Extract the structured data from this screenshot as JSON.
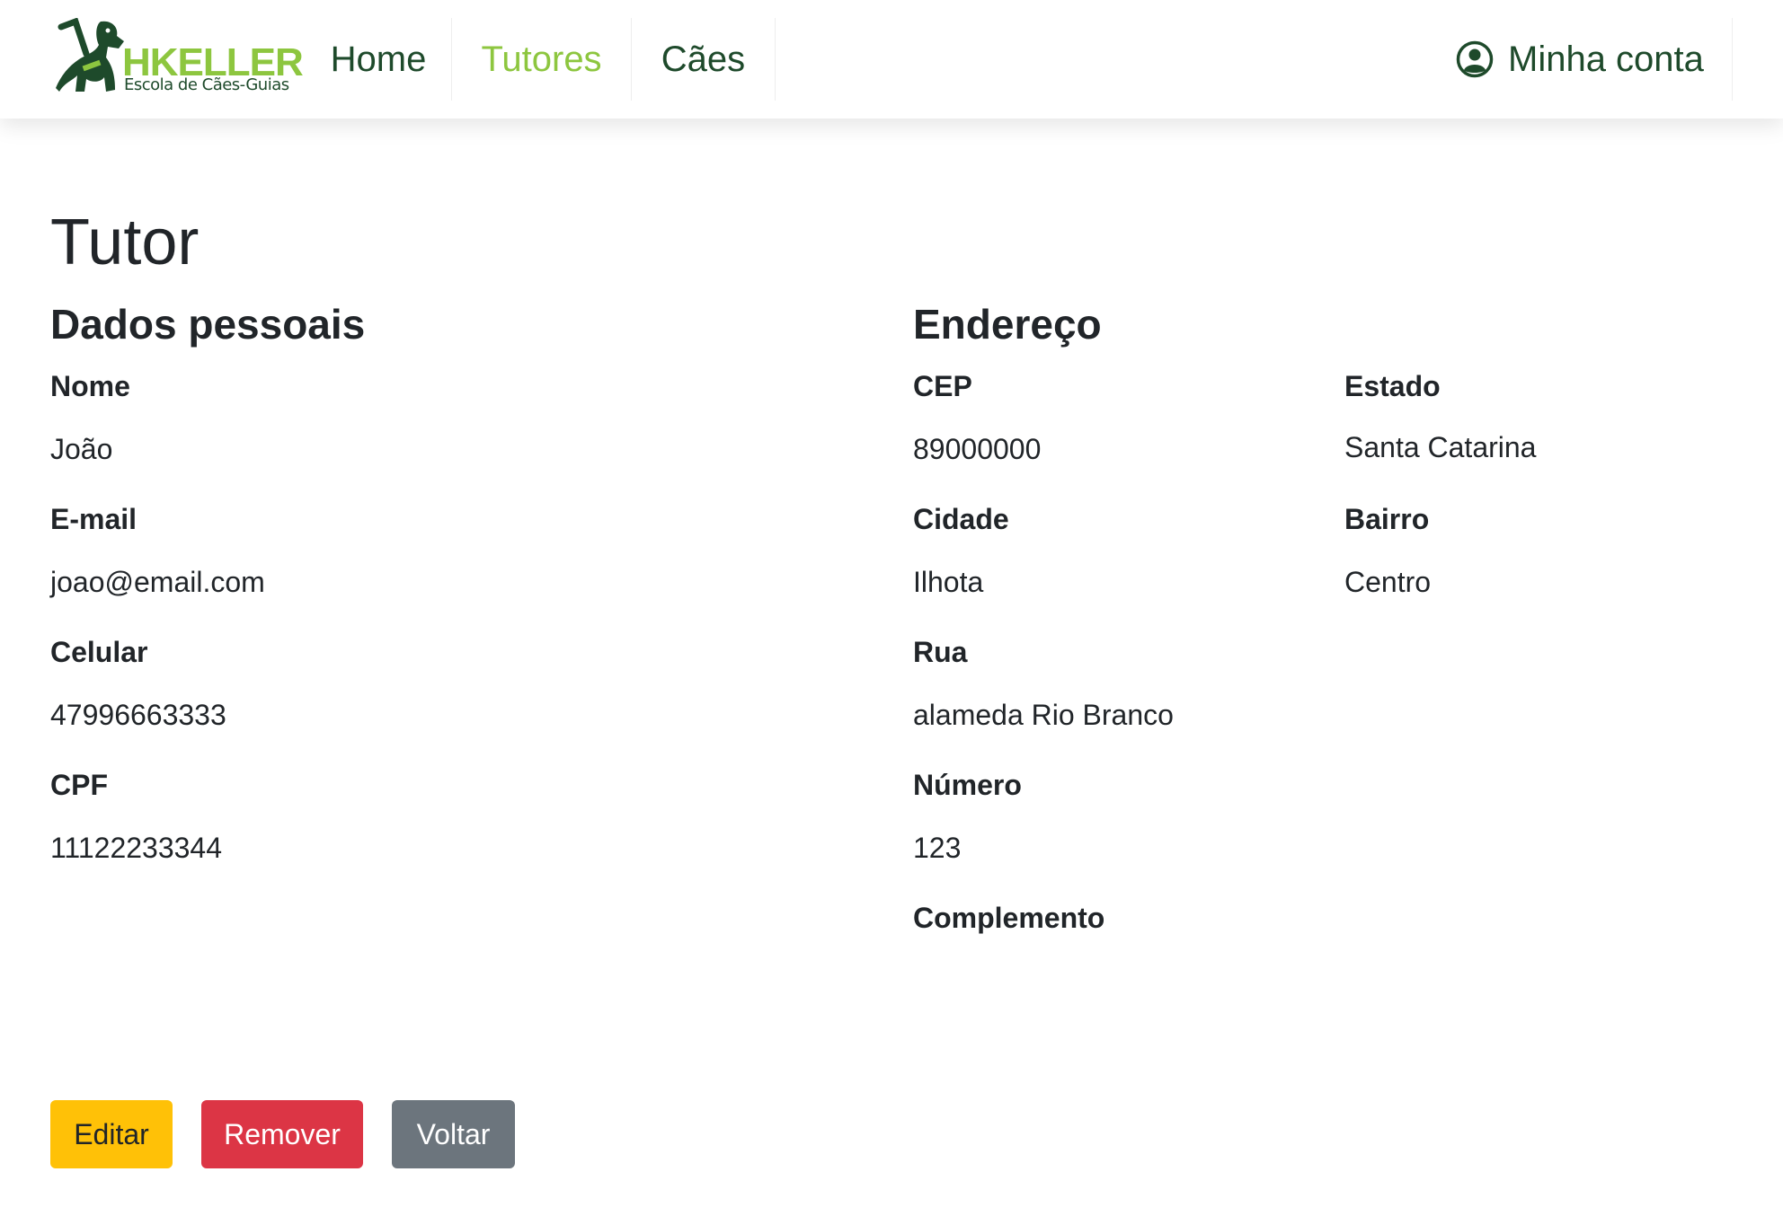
{
  "brand": {
    "name": "HKELLER",
    "subtitle": "Escola de Cães-Guias",
    "primary_color": "#1e4a2b",
    "accent_color": "#8dc63f"
  },
  "nav": {
    "items": [
      {
        "label": "Home",
        "active": false
      },
      {
        "label": "Tutores",
        "active": true
      },
      {
        "label": "Cães",
        "active": false
      }
    ],
    "account_label": "Minha conta",
    "account_icon": "user-circle-icon"
  },
  "page": {
    "title": "Tutor"
  },
  "personal": {
    "heading": "Dados pessoais",
    "fields": [
      {
        "label": "Nome",
        "value": "João"
      },
      {
        "label": "E-mail",
        "value": "joao@email.com"
      },
      {
        "label": "Celular",
        "value": "47996663333"
      },
      {
        "label": "CPF",
        "value": "11122233344"
      }
    ]
  },
  "address": {
    "heading": "Endereço",
    "cep": {
      "label": "CEP",
      "value": "89000000"
    },
    "estado": {
      "label": "Estado",
      "value": "Santa Catarina"
    },
    "cidade": {
      "label": "Cidade",
      "value": "Ilhota"
    },
    "bairro": {
      "label": "Bairro",
      "value": "Centro"
    },
    "rua": {
      "label": "Rua",
      "value": "alameda Rio Branco"
    },
    "numero": {
      "label": "Número",
      "value": "123"
    },
    "complemento": {
      "label": "Complemento",
      "value": ""
    }
  },
  "actions": {
    "edit_label": "Editar",
    "remove_label": "Remover",
    "back_label": "Voltar",
    "colors": {
      "edit": "#ffc107",
      "remove": "#dc3545",
      "back": "#6c757d"
    }
  }
}
